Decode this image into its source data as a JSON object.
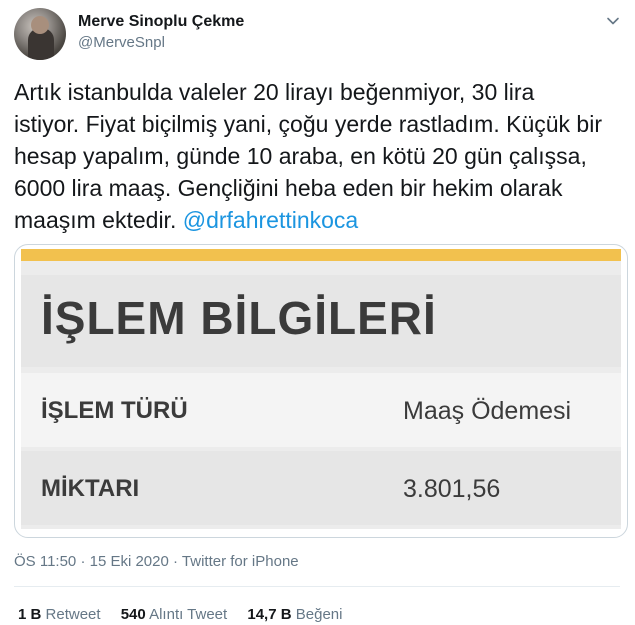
{
  "author": {
    "display_name": "Merve Sinoplu Çekme",
    "handle": "@MerveSnpl"
  },
  "tweet": {
    "lines": [
      "Artık istanbulda valeler 20 lirayı beğenmiyor, 30 lira",
      "istiyor. Fiyat biçilmiş yani, çoğu yerde rastladım. Küçük bir",
      "hesap yapalım, günde 10 araba, en kötü 20 gün çalışsa,",
      "6000 lira maaş. Gençliğini heba eden bir hekim olarak",
      "maaşım ektedir."
    ],
    "mention": "@drfahrettinkoca"
  },
  "image": {
    "title": "İŞLEM BİLGİLERİ",
    "rows": [
      {
        "label": "İŞLEM TÜRÜ",
        "value": "Maaş Ödemesi"
      },
      {
        "label": "MİKTARI",
        "value": "3.801,56"
      }
    ]
  },
  "meta": {
    "time": "ÖS 11:50",
    "separator": "·",
    "date": "15 Eki 2020",
    "source": "Twitter for iPhone"
  },
  "stats": {
    "retweets_count": "1 B",
    "retweets_label": "Retweet",
    "quotes_count": "540",
    "quotes_label": "Alıntı Tweet",
    "likes_count": "14,7 B",
    "likes_label": "Beğeni"
  },
  "icons": {
    "more": "chevron-down-icon"
  },
  "colors": {
    "link": "#1b95e0",
    "muted": "#657786",
    "card_accent": "#f2c14e"
  }
}
